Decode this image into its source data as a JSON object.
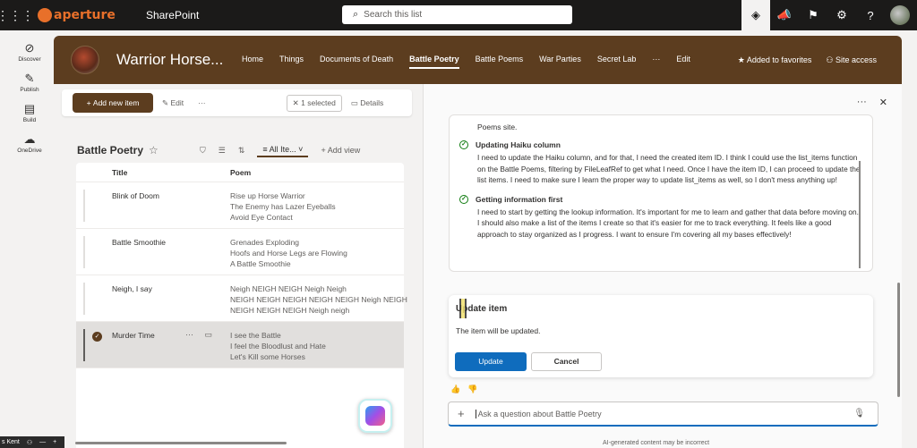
{
  "suite": {
    "logo_text": "aperture",
    "app_name": "SharePoint",
    "search_placeholder": "Search this list"
  },
  "appbar": {
    "items": [
      {
        "label": "Discover",
        "icon": "compass-icon"
      },
      {
        "label": "Publish",
        "icon": "pen-icon"
      },
      {
        "label": "Build",
        "icon": "build-icon"
      },
      {
        "label": "OneDrive",
        "icon": "cloud-icon"
      }
    ]
  },
  "site": {
    "title": "Warrior Horse...",
    "nav": [
      "Home",
      "Things",
      "Documents of Death",
      "Battle Poetry",
      "Battle Poems",
      "War Parties",
      "Secret Lab",
      "···",
      "Edit"
    ],
    "selected_nav": "Battle Poetry",
    "favorites_label": "Added to favorites",
    "site_access_label": "Site access",
    "brand_color": "#5c3d1f"
  },
  "commandbar": {
    "add_label": "Add new item",
    "edit_label": "Edit",
    "more_label": "···",
    "selected_label": "1 selected",
    "details_label": "Details"
  },
  "list": {
    "title": "Battle Poetry",
    "view_label": "All Ite...",
    "add_view_label": "Add view",
    "columns": [
      "Title",
      "Poem"
    ],
    "rows": [
      {
        "title": "Blink of Doom",
        "poem": [
          "Rise up Horse Warrior",
          "The Enemy has Lazer Eyeballs",
          "Avoid Eye Contact"
        ],
        "selected": false
      },
      {
        "title": "Battle Smoothie",
        "poem": [
          "Grenades Exploding",
          "Hoofs and Horse Legs are Flowing",
          "A Battle Smoothie"
        ],
        "selected": false
      },
      {
        "title": "Neigh, I say",
        "poem": [
          "Neigh NEIGH NEIGH Neigh Neigh",
          "NEIGH NEIGH NEIGH NEIGH NEIGH Neigh NEIGH",
          "NEIGH NEIGH NEIGH Neigh neigh"
        ],
        "selected": false
      },
      {
        "title": "Murder Time",
        "poem": [
          "I see the Battle",
          "I feel the Bloodlust and Hate",
          "Let's Kill some Horses"
        ],
        "selected": true
      }
    ]
  },
  "copilot": {
    "intro_text": "Poems site.",
    "steps": [
      {
        "heading": "Updating Haiku column",
        "body": "I need to update the Haiku column, and for that, I need the created item ID. I think I could use the list_items function on the Battle Poems, filtering by FileLeafRef to get what I need. Once I have the item ID, I can proceed to update the list items. I need to make sure I learn the proper way to update list_items as well, so I don't mess anything up!"
      },
      {
        "heading": "Getting information first",
        "body": "I need to start by getting the lookup information. It's important for me to learn and gather that data before moving on. I should also make a list of the items I create so that it's easier for me to track everything. It feels like a good approach to stay organized as I progress. I want to ensure I'm covering all my bases effectively!"
      }
    ],
    "card": {
      "title": "Update item",
      "description": "The item will be updated.",
      "primary_label": "Update",
      "secondary_label": "Cancel"
    },
    "ask_placeholder": "Ask a question about Battle Poetry",
    "disclaimer": "AI-generated content may be incorrect"
  },
  "taskbar": {
    "user_fragment": "s Kent"
  }
}
